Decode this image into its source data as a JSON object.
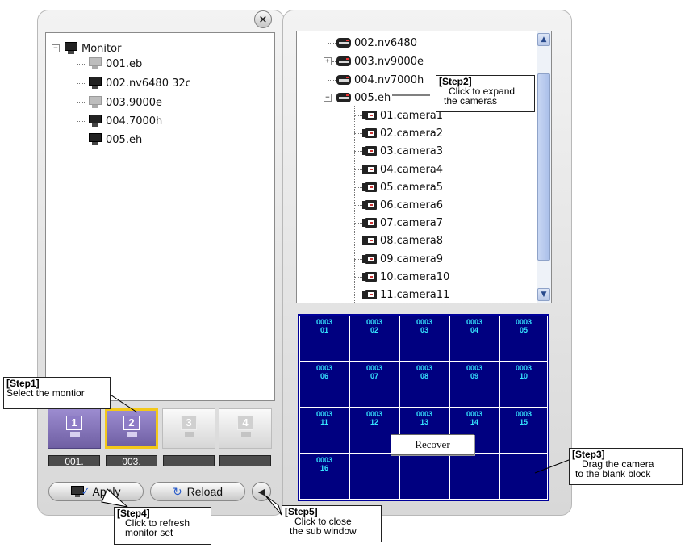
{
  "left_tree": {
    "root": "Monitor",
    "items": [
      "001.eb",
      "002.nv6480 32c",
      "003.9000e",
      "004.7000h",
      "005.eh"
    ]
  },
  "right_tree": {
    "servers": [
      "002.nv6480",
      "003.nv9000e",
      "004.nv7000h",
      "005.eh"
    ],
    "cameras": [
      "01.camera1",
      "02.camera2",
      "03.camera3",
      "04.camera4",
      "05.camera5",
      "06.camera6",
      "07.camera7",
      "08.camera8",
      "09.camera9",
      "10.camera10",
      "11.camera11"
    ]
  },
  "grid": {
    "cells": [
      {
        "a": "0003",
        "b": "01"
      },
      {
        "a": "0003",
        "b": "02"
      },
      {
        "a": "0003",
        "b": "03"
      },
      {
        "a": "0003",
        "b": "04"
      },
      {
        "a": "0003",
        "b": "05"
      },
      {
        "a": "0003",
        "b": "06"
      },
      {
        "a": "0003",
        "b": "07"
      },
      {
        "a": "0003",
        "b": "08"
      },
      {
        "a": "0003",
        "b": "09"
      },
      {
        "a": "0003",
        "b": "10"
      },
      {
        "a": "0003",
        "b": "11"
      },
      {
        "a": "0003",
        "b": "12"
      },
      {
        "a": "0003",
        "b": "13"
      },
      {
        "a": "0003",
        "b": "14"
      },
      {
        "a": "0003",
        "b": "15"
      },
      {
        "a": "0003",
        "b": "16"
      },
      {
        "a": "",
        "b": ""
      },
      {
        "a": "",
        "b": ""
      },
      {
        "a": "",
        "b": ""
      },
      {
        "a": "",
        "b": ""
      }
    ],
    "context_menu": "Recover"
  },
  "monitor_buttons": [
    {
      "num": "1",
      "label": "001."
    },
    {
      "num": "2",
      "label": "003."
    },
    {
      "num": "3",
      "label": ""
    },
    {
      "num": "4",
      "label": ""
    }
  ],
  "buttons": {
    "apply": "Apply",
    "reload": "Reload",
    "close": "×",
    "collapse": "◀"
  },
  "callouts": {
    "step1": {
      "title": "[Step1]",
      "l1": "Select the montior",
      "l2": ""
    },
    "step2": {
      "title": "[Step2]",
      "l1": "Click to expand",
      "l2": "the cameras"
    },
    "step3": {
      "title": "[Step3]",
      "l1": "Drag the camera",
      "l2": "to the blank block"
    },
    "step4": {
      "title": "[Step4]",
      "l1": "Click to refresh",
      "l2": "monitor set"
    },
    "step5": {
      "title": "[Step5]",
      "l1": "Click to close",
      "l2": "the sub window"
    }
  },
  "colors": {
    "grid_bg": "#000080",
    "grid_text": "#36e6ff",
    "selected_monitor": "#7a6aa8",
    "selected_border": "#f3c81a"
  }
}
